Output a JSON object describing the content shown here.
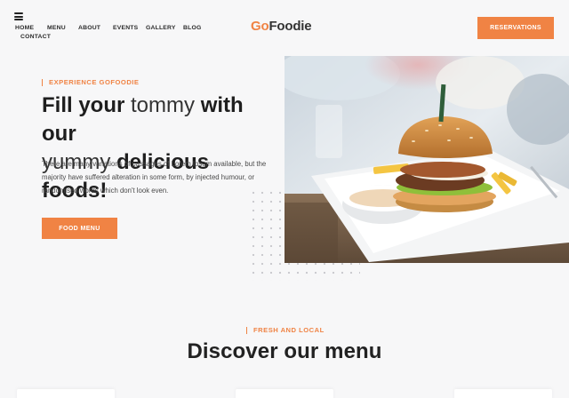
{
  "header": {
    "nav": [
      "HOME",
      "MENU",
      "ABOUT",
      "EVENTS",
      "GALLERY",
      "BLOG",
      "CONTACT"
    ],
    "logo": {
      "go": "Go",
      "foodie": "Foodie"
    },
    "reservations_label": "RESERVATIONS"
  },
  "hero": {
    "eyebrow": "EXPERIENCE GOFOODIE",
    "title": {
      "line1_a": "Fill your",
      "line1_b": " tommy ",
      "line1_c": "with our",
      "line2_a": "yummy",
      "line2_b": " delicious foods!"
    },
    "description": "There are many variations of passages of Lorem Ipsum available, but the majority have suffered alteration in some form, by injected humour, or randomised words which don't look even.",
    "button_label": "FOOD MENU"
  },
  "menu_section": {
    "eyebrow": "FRESH AND LOCAL",
    "title": "Discover our menu"
  },
  "colors": {
    "accent": "#f08344",
    "background": "#f7f7f8",
    "text": "#222222"
  },
  "icons": [
    "hamburger-menu-icon"
  ]
}
